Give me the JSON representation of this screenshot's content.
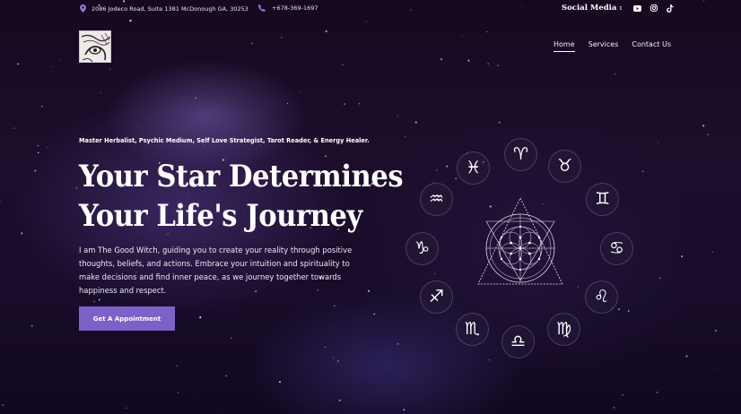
{
  "topbar": {
    "address": "2086 Jodeco Road, Suite 1381 McDonough GA, 30253",
    "phone": "+678-369-1697",
    "social_label": "Social Media :",
    "social_icons": [
      "youtube-icon",
      "instagram-icon",
      "tiktok-icon"
    ]
  },
  "nav": {
    "items": [
      "Home",
      "Services",
      "Contact Us"
    ],
    "active": "Home"
  },
  "hero": {
    "tagline": "Master Herbalist, Psychic Medium, Self Love Strategist, Tarot Reader, & Energy Healer.",
    "title_line1": "Your Star Determines",
    "title_line2": "Your Life's Journey",
    "description": "I am The Good Witch, guiding you to create your reality through positive thoughts, beliefs, and actions. Embrace your intuition and spirituality to make decisions and find inner peace, as we journey together towards happiness and respect.",
    "cta_label": "Get A Appointment"
  },
  "zodiac": [
    {
      "name": "aries",
      "glyph": "♈︎"
    },
    {
      "name": "taurus",
      "glyph": "♉︎"
    },
    {
      "name": "gemini",
      "glyph": "♊︎"
    },
    {
      "name": "cancer",
      "glyph": "♋︎"
    },
    {
      "name": "leo",
      "glyph": "♌︎"
    },
    {
      "name": "virgo",
      "glyph": "♍︎"
    },
    {
      "name": "libra",
      "glyph": "♎︎"
    },
    {
      "name": "scorpio",
      "glyph": "♏︎"
    },
    {
      "name": "sagittarius",
      "glyph": "♐︎"
    },
    {
      "name": "capricorn",
      "glyph": "♑︎"
    },
    {
      "name": "aquarius",
      "glyph": "♒︎"
    },
    {
      "name": "pisces",
      "glyph": "♓︎"
    }
  ],
  "colors": {
    "accent": "#7a62c9",
    "icon_accent": "#8b78d8",
    "background": "#180c2a"
  }
}
